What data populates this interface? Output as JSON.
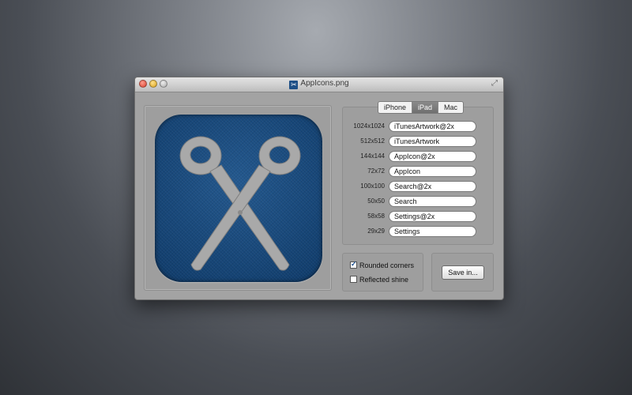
{
  "window": {
    "title": "AppIcons.png"
  },
  "tabs": [
    {
      "label": "iPhone",
      "selected": false
    },
    {
      "label": "iPad",
      "selected": true
    },
    {
      "label": "Mac",
      "selected": false
    }
  ],
  "sizes": [
    {
      "size": "1024x1024",
      "name": "iTunesArtwork@2x"
    },
    {
      "size": "512x512",
      "name": "iTunesArtwork"
    },
    {
      "size": "144x144",
      "name": "AppIcon@2x"
    },
    {
      "size": "72x72",
      "name": "AppIcon"
    },
    {
      "size": "100x100",
      "name": "Search@2x"
    },
    {
      "size": "50x50",
      "name": "Search"
    },
    {
      "size": "58x58",
      "name": "Settings@2x"
    },
    {
      "size": "29x29",
      "name": "Settings"
    }
  ],
  "options": {
    "rounded_corners": {
      "label": "Rounded corners",
      "checked": true
    },
    "reflected_shine": {
      "label": "Reflected shine",
      "checked": false
    }
  },
  "save_label": "Save in...",
  "icon": {
    "name": "scissors-icon",
    "background": "#1d4f86",
    "foreground": "#a9a9a9"
  }
}
